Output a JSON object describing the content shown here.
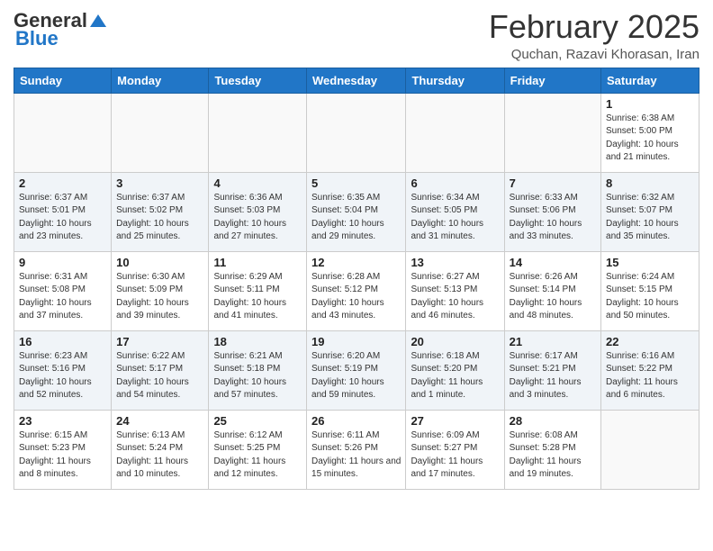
{
  "header": {
    "logo_general": "General",
    "logo_blue": "Blue",
    "month_title": "February 2025",
    "location": "Quchan, Razavi Khorasan, Iran"
  },
  "weekdays": [
    "Sunday",
    "Monday",
    "Tuesday",
    "Wednesday",
    "Thursday",
    "Friday",
    "Saturday"
  ],
  "weeks": [
    [
      {
        "day": "",
        "info": ""
      },
      {
        "day": "",
        "info": ""
      },
      {
        "day": "",
        "info": ""
      },
      {
        "day": "",
        "info": ""
      },
      {
        "day": "",
        "info": ""
      },
      {
        "day": "",
        "info": ""
      },
      {
        "day": "1",
        "info": "Sunrise: 6:38 AM\nSunset: 5:00 PM\nDaylight: 10 hours and 21 minutes."
      }
    ],
    [
      {
        "day": "2",
        "info": "Sunrise: 6:37 AM\nSunset: 5:01 PM\nDaylight: 10 hours and 23 minutes."
      },
      {
        "day": "3",
        "info": "Sunrise: 6:37 AM\nSunset: 5:02 PM\nDaylight: 10 hours and 25 minutes."
      },
      {
        "day": "4",
        "info": "Sunrise: 6:36 AM\nSunset: 5:03 PM\nDaylight: 10 hours and 27 minutes."
      },
      {
        "day": "5",
        "info": "Sunrise: 6:35 AM\nSunset: 5:04 PM\nDaylight: 10 hours and 29 minutes."
      },
      {
        "day": "6",
        "info": "Sunrise: 6:34 AM\nSunset: 5:05 PM\nDaylight: 10 hours and 31 minutes."
      },
      {
        "day": "7",
        "info": "Sunrise: 6:33 AM\nSunset: 5:06 PM\nDaylight: 10 hours and 33 minutes."
      },
      {
        "day": "8",
        "info": "Sunrise: 6:32 AM\nSunset: 5:07 PM\nDaylight: 10 hours and 35 minutes."
      }
    ],
    [
      {
        "day": "9",
        "info": "Sunrise: 6:31 AM\nSunset: 5:08 PM\nDaylight: 10 hours and 37 minutes."
      },
      {
        "day": "10",
        "info": "Sunrise: 6:30 AM\nSunset: 5:09 PM\nDaylight: 10 hours and 39 minutes."
      },
      {
        "day": "11",
        "info": "Sunrise: 6:29 AM\nSunset: 5:11 PM\nDaylight: 10 hours and 41 minutes."
      },
      {
        "day": "12",
        "info": "Sunrise: 6:28 AM\nSunset: 5:12 PM\nDaylight: 10 hours and 43 minutes."
      },
      {
        "day": "13",
        "info": "Sunrise: 6:27 AM\nSunset: 5:13 PM\nDaylight: 10 hours and 46 minutes."
      },
      {
        "day": "14",
        "info": "Sunrise: 6:26 AM\nSunset: 5:14 PM\nDaylight: 10 hours and 48 minutes."
      },
      {
        "day": "15",
        "info": "Sunrise: 6:24 AM\nSunset: 5:15 PM\nDaylight: 10 hours and 50 minutes."
      }
    ],
    [
      {
        "day": "16",
        "info": "Sunrise: 6:23 AM\nSunset: 5:16 PM\nDaylight: 10 hours and 52 minutes."
      },
      {
        "day": "17",
        "info": "Sunrise: 6:22 AM\nSunset: 5:17 PM\nDaylight: 10 hours and 54 minutes."
      },
      {
        "day": "18",
        "info": "Sunrise: 6:21 AM\nSunset: 5:18 PM\nDaylight: 10 hours and 57 minutes."
      },
      {
        "day": "19",
        "info": "Sunrise: 6:20 AM\nSunset: 5:19 PM\nDaylight: 10 hours and 59 minutes."
      },
      {
        "day": "20",
        "info": "Sunrise: 6:18 AM\nSunset: 5:20 PM\nDaylight: 11 hours and 1 minute."
      },
      {
        "day": "21",
        "info": "Sunrise: 6:17 AM\nSunset: 5:21 PM\nDaylight: 11 hours and 3 minutes."
      },
      {
        "day": "22",
        "info": "Sunrise: 6:16 AM\nSunset: 5:22 PM\nDaylight: 11 hours and 6 minutes."
      }
    ],
    [
      {
        "day": "23",
        "info": "Sunrise: 6:15 AM\nSunset: 5:23 PM\nDaylight: 11 hours and 8 minutes."
      },
      {
        "day": "24",
        "info": "Sunrise: 6:13 AM\nSunset: 5:24 PM\nDaylight: 11 hours and 10 minutes."
      },
      {
        "day": "25",
        "info": "Sunrise: 6:12 AM\nSunset: 5:25 PM\nDaylight: 11 hours and 12 minutes."
      },
      {
        "day": "26",
        "info": "Sunrise: 6:11 AM\nSunset: 5:26 PM\nDaylight: 11 hours and 15 minutes."
      },
      {
        "day": "27",
        "info": "Sunrise: 6:09 AM\nSunset: 5:27 PM\nDaylight: 11 hours and 17 minutes."
      },
      {
        "day": "28",
        "info": "Sunrise: 6:08 AM\nSunset: 5:28 PM\nDaylight: 11 hours and 19 minutes."
      },
      {
        "day": "",
        "info": ""
      }
    ]
  ]
}
